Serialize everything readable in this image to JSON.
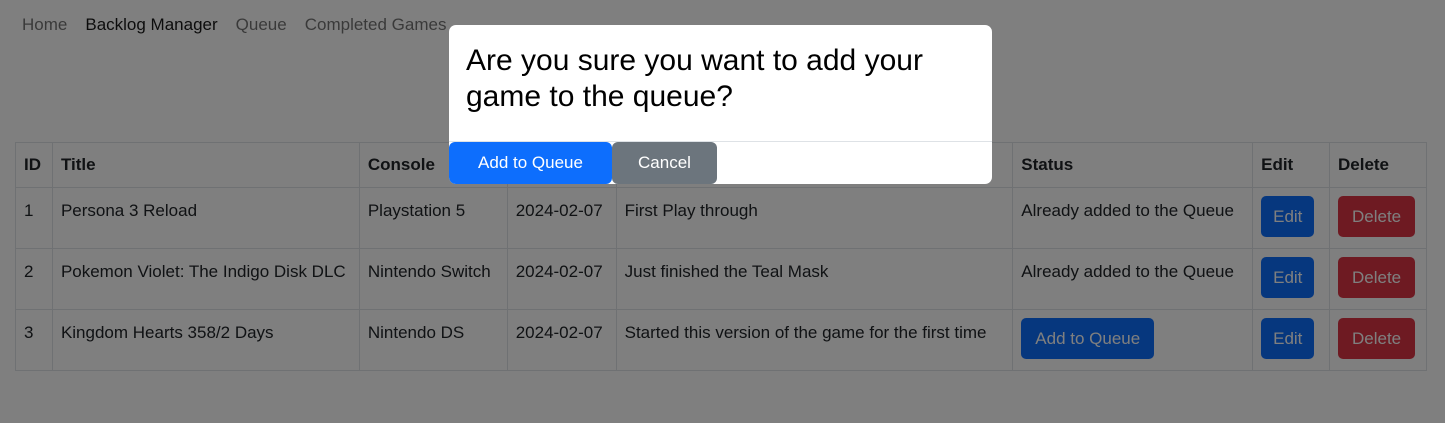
{
  "navbar": {
    "links": [
      {
        "label": "Home"
      },
      {
        "label": "Backlog Manager"
      },
      {
        "label": "Queue"
      },
      {
        "label": "Completed Games"
      }
    ]
  },
  "table": {
    "headers": {
      "id": "ID",
      "title": "Title",
      "console": "Console",
      "date": "",
      "notes": "",
      "status": "Status",
      "edit": "Edit",
      "delete": "Delete"
    },
    "rows": [
      {
        "id": "1",
        "title": "Persona 3 Reload",
        "console": "Playstation 5",
        "date": "2024-02-07",
        "notes": "First Play through",
        "status": "Already added to the Queue",
        "edit_label": "Edit",
        "delete_label": "Delete"
      },
      {
        "id": "2",
        "title": "Pokemon Violet: The Indigo Disk DLC",
        "console": "Nintendo Switch",
        "date": "2024-02-07",
        "notes": "Just finished the Teal Mask",
        "status": "Already added to the Queue",
        "edit_label": "Edit",
        "delete_label": "Delete"
      },
      {
        "id": "3",
        "title": "Kingdom Hearts 358/2 Days",
        "console": "Nintendo DS",
        "date": "2024-02-07",
        "notes": "Started this version of the game for the first time",
        "status_button": "Add to Queue",
        "edit_label": "Edit",
        "delete_label": "Delete"
      }
    ]
  },
  "modal": {
    "title": "Are you sure you want to add your game to the queue?",
    "confirm_label": "Add to Queue",
    "cancel_label": "Cancel"
  },
  "colors": {
    "primary": "#0d6efd",
    "danger": "#dc3545",
    "secondary": "#6c757d",
    "overlay": "rgba(0,0,0,0.5)"
  }
}
